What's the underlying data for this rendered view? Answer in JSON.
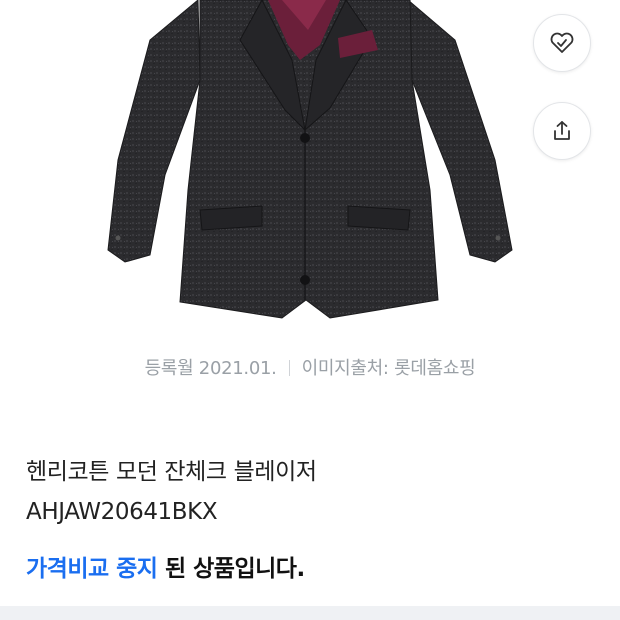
{
  "actions": {
    "wishlist_icon": "heart-check-icon",
    "share_icon": "share-icon"
  },
  "image_meta": {
    "registered": "등록월 2021.01.",
    "source": "이미지출처: 롯데홈쇼핑"
  },
  "product": {
    "name_line1": "헨리코튼 모던 잔체크 블레이저",
    "name_line2": "AHJAW20641BKX"
  },
  "status": {
    "highlight": "가격비교 중지",
    "rest": " 된 상품입니다."
  },
  "colors": {
    "accent": "#1a6ef0",
    "meta_text": "#9aa0a6",
    "jacket": "#2a2a2c",
    "lining": "#6b1f3a"
  }
}
